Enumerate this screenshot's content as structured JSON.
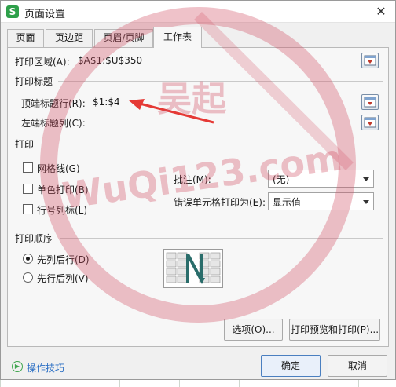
{
  "window": {
    "title": "页面设置",
    "app_icon_letter": "S",
    "close_glyph": "✕"
  },
  "tabs": [
    {
      "label": "页面"
    },
    {
      "label": "页边距"
    },
    {
      "label": "页眉/页脚"
    },
    {
      "label": "工作表",
      "active": true
    }
  ],
  "print_area": {
    "label": "打印区域(A):",
    "value": "$A$1:$U$350"
  },
  "print_titles": {
    "section": "打印标题",
    "top_rows_label": "顶端标题行(R):",
    "top_rows_value": "$1:$4",
    "left_cols_label": "左端标题列(C):",
    "left_cols_value": ""
  },
  "print": {
    "section": "打印",
    "gridlines_label": "网格线(G)",
    "mono_label": "单色打印(B)",
    "headings_label": "行号列标(L)",
    "comments_label": "批注(M):",
    "comments_value": "(无)",
    "errors_label": "错误单元格打印为(E):",
    "errors_value": "显示值"
  },
  "order": {
    "section": "打印顺序",
    "down_then_over": "先列后行(D)",
    "over_then_down": "先行后列(V)",
    "selected": "down_then_over"
  },
  "buttons": {
    "options": "选项(O)...",
    "preview_print": "打印预览和打印(P)...",
    "ok": "确定",
    "cancel": "取消"
  },
  "footer": {
    "tips_label": "操作技巧"
  },
  "watermark": {
    "cn": "吴起",
    "site": "WuQi123.com"
  },
  "colors": {
    "accent": "#2b6fc4",
    "arrow": "#e53935",
    "watermark": "#d25064"
  },
  "icons": {
    "range_picker": "range-picker-icon",
    "help": "help-circle-icon"
  }
}
